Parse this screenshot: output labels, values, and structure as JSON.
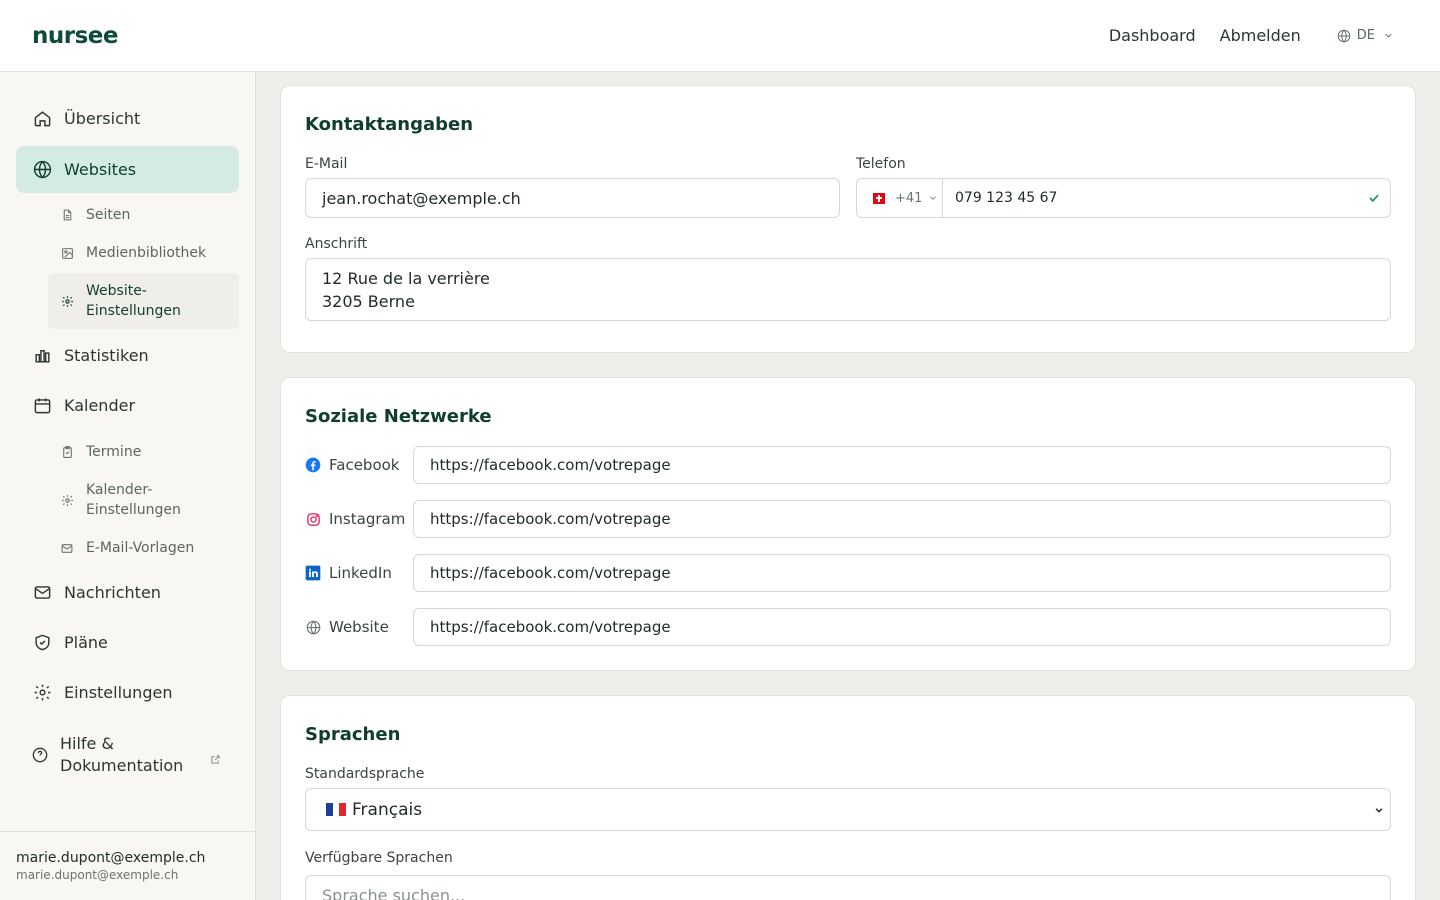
{
  "app": {
    "logo": "nursee"
  },
  "header": {
    "links": [
      "Dashboard",
      "Abmelden"
    ],
    "language": "DE"
  },
  "sidebar": {
    "items": [
      {
        "label": "Übersicht",
        "icon": "home-icon"
      },
      {
        "label": "Websites",
        "icon": "globe-icon",
        "active": true
      },
      {
        "label": "Statistiken",
        "icon": "bar-chart-icon"
      },
      {
        "label": "Kalender",
        "icon": "calendar-icon"
      },
      {
        "label": "Nachrichten",
        "icon": "mail-icon"
      },
      {
        "label": "Pläne",
        "icon": "shield-icon"
      },
      {
        "label": "Einstellungen",
        "icon": "gear-icon"
      },
      {
        "label_line1": "Hilfe &",
        "label_line2": "Dokumentation",
        "icon": "help-circle-icon"
      }
    ],
    "website_sub": [
      {
        "label": "Seiten",
        "icon": "document-icon"
      },
      {
        "label": "Medienbibliothek",
        "icon": "image-icon"
      },
      {
        "label_line1": "Website-",
        "label_line2": "Einstellungen",
        "icon": "gear-icon",
        "active": true
      }
    ],
    "calendar_sub": [
      {
        "label": "Termine",
        "icon": "clipboard-icon"
      },
      {
        "label_line1": "Kalender-",
        "label_line2": "Einstellungen",
        "icon": "gear-icon"
      },
      {
        "label": "E-Mail-Vorlagen",
        "icon": "mail-icon"
      }
    ],
    "user": {
      "name": "marie.dupont@exemple.ch",
      "email": "marie.dupont@exemple.ch"
    }
  },
  "contact": {
    "title": "Kontaktangaben",
    "email_label": "E-Mail",
    "email_value": "jean.rochat@exemple.ch",
    "phone_label": "Telefon",
    "phone_prefix": "+41",
    "phone_value": "079 123 45 67",
    "address_label": "Anschrift",
    "address_line1": "12 Rue de la verrière",
    "address_line2": "3205 Berne"
  },
  "social": {
    "title": "Soziale Netzwerke",
    "items": [
      {
        "label": "Facebook",
        "icon": "facebook-icon",
        "value": "https://facebook.com/votrepage"
      },
      {
        "label": "Instagram",
        "icon": "instagram-icon",
        "value": "https://facebook.com/votrepage"
      },
      {
        "label": "LinkedIn",
        "icon": "linkedin-icon",
        "value": "https://facebook.com/votrepage"
      },
      {
        "label": "Website",
        "icon": "globe-icon",
        "value": "https://facebook.com/votrepage"
      }
    ]
  },
  "languages": {
    "title": "Sprachen",
    "default_label": "Standardsprache",
    "default_value": "Français",
    "available_label": "Verfügbare Sprachen",
    "search_placeholder": "Sprache suchen..."
  },
  "colors": {
    "brand": "#0f4a3a",
    "active_bg": "#d3ebe2",
    "success": "#1f9a6a",
    "facebook": "#1877f2",
    "instagram": "#e1306c",
    "linkedin": "#0a66c2"
  }
}
